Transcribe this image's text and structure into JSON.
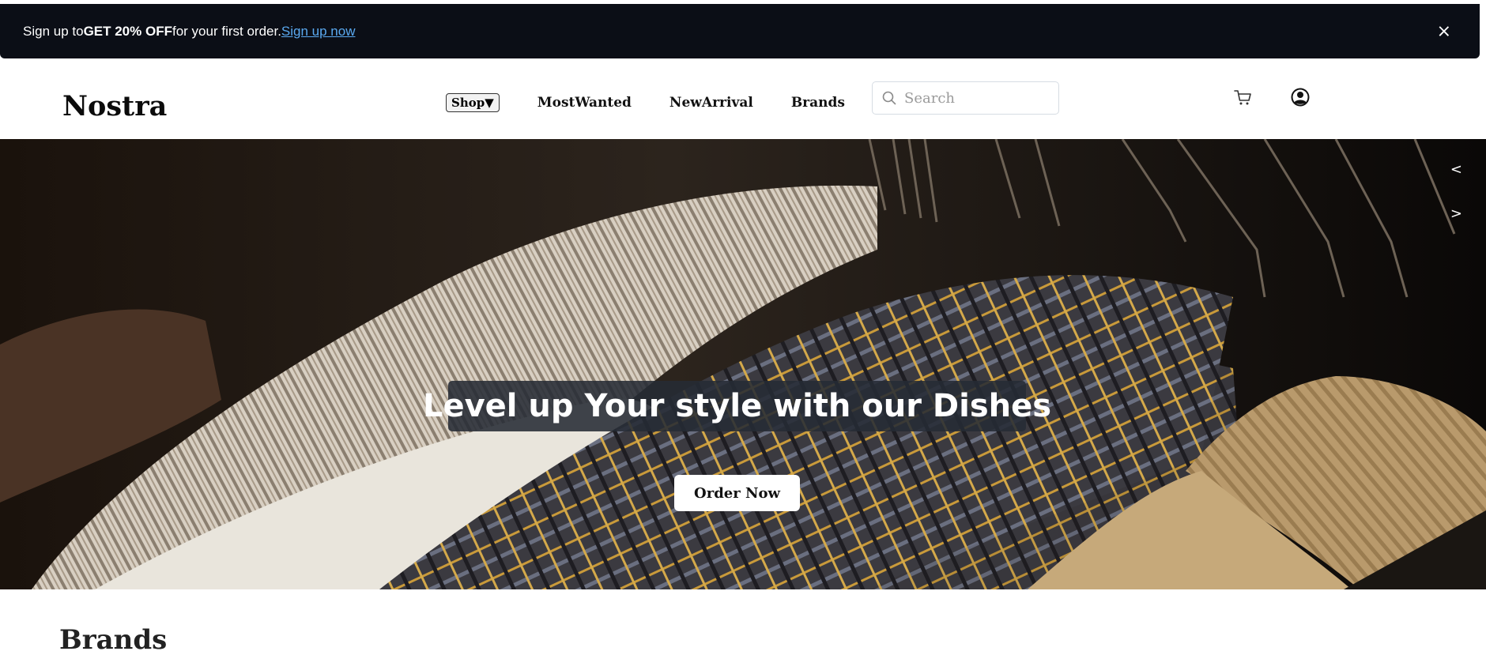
{
  "promo": {
    "text_before": "Sign up to ",
    "text_bold": "GET 20% OFF",
    "text_after": " for your first order.",
    "link": "Sign up now",
    "close": "×"
  },
  "header": {
    "logo": "Nostra",
    "nav": {
      "shop": "Shop▼",
      "links": [
        "MostWanted",
        "NewArrival",
        "Brands"
      ]
    },
    "search": {
      "placeholder": "Search",
      "value": ""
    },
    "icons": [
      "search-icon",
      "cart-icon",
      "user-icon"
    ]
  },
  "hero": {
    "title": "Level up Your style with our Dishes",
    "cta": "Order Now",
    "prev": "<",
    "next": ">"
  },
  "brands": {
    "title": "Brands"
  },
  "colors": {
    "promo_bg": "#0b0e16",
    "link": "#5aa9f0",
    "hero_caption_bg": "#262b34"
  }
}
